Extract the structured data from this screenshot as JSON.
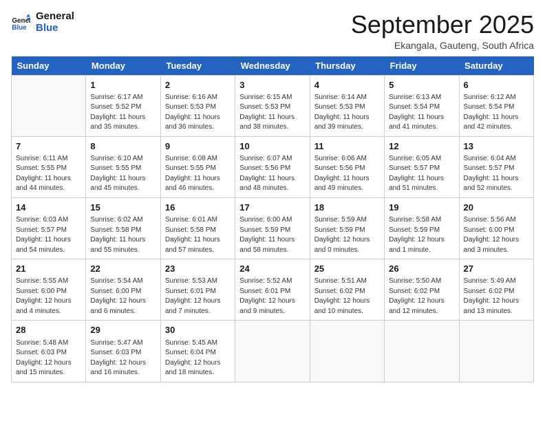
{
  "logo": {
    "text_general": "General",
    "text_blue": "Blue"
  },
  "title": "September 2025",
  "subtitle": "Ekangala, Gauteng, South Africa",
  "days_header": [
    "Sunday",
    "Monday",
    "Tuesday",
    "Wednesday",
    "Thursday",
    "Friday",
    "Saturday"
  ],
  "weeks": [
    [
      {
        "day": "",
        "info": ""
      },
      {
        "day": "1",
        "info": "Sunrise: 6:17 AM\nSunset: 5:52 PM\nDaylight: 11 hours\nand 35 minutes."
      },
      {
        "day": "2",
        "info": "Sunrise: 6:16 AM\nSunset: 5:53 PM\nDaylight: 11 hours\nand 36 minutes."
      },
      {
        "day": "3",
        "info": "Sunrise: 6:15 AM\nSunset: 5:53 PM\nDaylight: 11 hours\nand 38 minutes."
      },
      {
        "day": "4",
        "info": "Sunrise: 6:14 AM\nSunset: 5:53 PM\nDaylight: 11 hours\nand 39 minutes."
      },
      {
        "day": "5",
        "info": "Sunrise: 6:13 AM\nSunset: 5:54 PM\nDaylight: 11 hours\nand 41 minutes."
      },
      {
        "day": "6",
        "info": "Sunrise: 6:12 AM\nSunset: 5:54 PM\nDaylight: 11 hours\nand 42 minutes."
      }
    ],
    [
      {
        "day": "7",
        "info": "Sunrise: 6:11 AM\nSunset: 5:55 PM\nDaylight: 11 hours\nand 44 minutes."
      },
      {
        "day": "8",
        "info": "Sunrise: 6:10 AM\nSunset: 5:55 PM\nDaylight: 11 hours\nand 45 minutes."
      },
      {
        "day": "9",
        "info": "Sunrise: 6:08 AM\nSunset: 5:55 PM\nDaylight: 11 hours\nand 46 minutes."
      },
      {
        "day": "10",
        "info": "Sunrise: 6:07 AM\nSunset: 5:56 PM\nDaylight: 11 hours\nand 48 minutes."
      },
      {
        "day": "11",
        "info": "Sunrise: 6:06 AM\nSunset: 5:56 PM\nDaylight: 11 hours\nand 49 minutes."
      },
      {
        "day": "12",
        "info": "Sunrise: 6:05 AM\nSunset: 5:57 PM\nDaylight: 11 hours\nand 51 minutes."
      },
      {
        "day": "13",
        "info": "Sunrise: 6:04 AM\nSunset: 5:57 PM\nDaylight: 11 hours\nand 52 minutes."
      }
    ],
    [
      {
        "day": "14",
        "info": "Sunrise: 6:03 AM\nSunset: 5:57 PM\nDaylight: 11 hours\nand 54 minutes."
      },
      {
        "day": "15",
        "info": "Sunrise: 6:02 AM\nSunset: 5:58 PM\nDaylight: 11 hours\nand 55 minutes."
      },
      {
        "day": "16",
        "info": "Sunrise: 6:01 AM\nSunset: 5:58 PM\nDaylight: 11 hours\nand 57 minutes."
      },
      {
        "day": "17",
        "info": "Sunrise: 6:00 AM\nSunset: 5:59 PM\nDaylight: 11 hours\nand 58 minutes."
      },
      {
        "day": "18",
        "info": "Sunrise: 5:59 AM\nSunset: 5:59 PM\nDaylight: 12 hours\nand 0 minutes."
      },
      {
        "day": "19",
        "info": "Sunrise: 5:58 AM\nSunset: 5:59 PM\nDaylight: 12 hours\nand 1 minute."
      },
      {
        "day": "20",
        "info": "Sunrise: 5:56 AM\nSunset: 6:00 PM\nDaylight: 12 hours\nand 3 minutes."
      }
    ],
    [
      {
        "day": "21",
        "info": "Sunrise: 5:55 AM\nSunset: 6:00 PM\nDaylight: 12 hours\nand 4 minutes."
      },
      {
        "day": "22",
        "info": "Sunrise: 5:54 AM\nSunset: 6:00 PM\nDaylight: 12 hours\nand 6 minutes."
      },
      {
        "day": "23",
        "info": "Sunrise: 5:53 AM\nSunset: 6:01 PM\nDaylight: 12 hours\nand 7 minutes."
      },
      {
        "day": "24",
        "info": "Sunrise: 5:52 AM\nSunset: 6:01 PM\nDaylight: 12 hours\nand 9 minutes."
      },
      {
        "day": "25",
        "info": "Sunrise: 5:51 AM\nSunset: 6:02 PM\nDaylight: 12 hours\nand 10 minutes."
      },
      {
        "day": "26",
        "info": "Sunrise: 5:50 AM\nSunset: 6:02 PM\nDaylight: 12 hours\nand 12 minutes."
      },
      {
        "day": "27",
        "info": "Sunrise: 5:49 AM\nSunset: 6:02 PM\nDaylight: 12 hours\nand 13 minutes."
      }
    ],
    [
      {
        "day": "28",
        "info": "Sunrise: 5:48 AM\nSunset: 6:03 PM\nDaylight: 12 hours\nand 15 minutes."
      },
      {
        "day": "29",
        "info": "Sunrise: 5:47 AM\nSunset: 6:03 PM\nDaylight: 12 hours\nand 16 minutes."
      },
      {
        "day": "30",
        "info": "Sunrise: 5:45 AM\nSunset: 6:04 PM\nDaylight: 12 hours\nand 18 minutes."
      },
      {
        "day": "",
        "info": ""
      },
      {
        "day": "",
        "info": ""
      },
      {
        "day": "",
        "info": ""
      },
      {
        "day": "",
        "info": ""
      }
    ]
  ]
}
